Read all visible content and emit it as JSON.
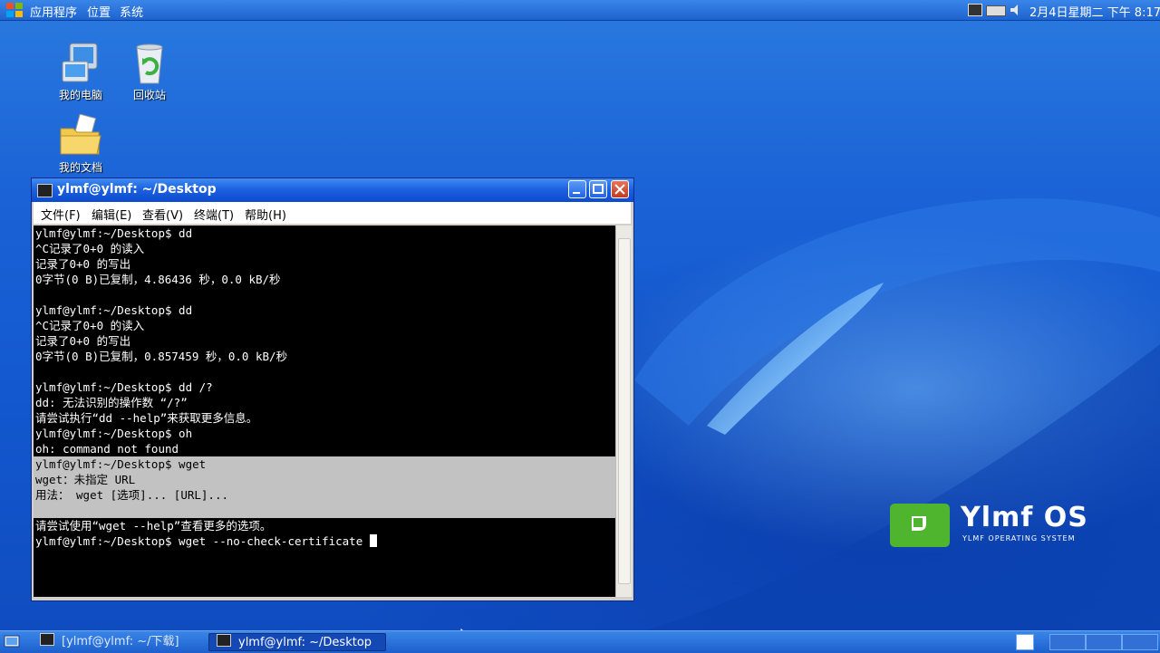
{
  "top_panel": {
    "menus": [
      "应用程序",
      "位置",
      "系统"
    ],
    "clock": "2月4日星期二 下午 8:17",
    "tray_icons": [
      "network-icon",
      "battery-icon",
      "volume-icon"
    ]
  },
  "desktop": {
    "icons": [
      {
        "label": "我的电脑",
        "icon": "computer-icon"
      },
      {
        "label": "回收站",
        "icon": "recycle-bin-icon"
      },
      {
        "label": "我的文档",
        "icon": "folder-icon"
      }
    ],
    "brand": {
      "name": "Ylmf OS",
      "tagline": "YLMF OPERATING SYSTEM"
    }
  },
  "terminal_window": {
    "title": "ylmf@ylmf: ~/Desktop",
    "menu": [
      "文件(F)",
      "编辑(E)",
      "查看(V)",
      "终端(T)",
      "帮助(H)"
    ],
    "lines": [
      "ylmf@ylmf:~/Desktop$ dd",
      "^C记录了0+0 的读入",
      "记录了0+0 的写出",
      "0字节(0 B)已复制，4.86436 秒，0.0 kB/秒",
      "",
      "ylmf@ylmf:~/Desktop$ dd",
      "^C记录了0+0 的读入",
      "记录了0+0 的写出",
      "0字节(0 B)已复制，0.857459 秒，0.0 kB/秒",
      "",
      "ylmf@ylmf:~/Desktop$ dd /?",
      "dd: 无法识别的操作数 “/?”",
      "请尝试执行“dd --help”来获取更多信息。",
      "ylmf@ylmf:~/Desktop$ oh",
      "oh: command not found",
      "ylmf@ylmf:~/Desktop$ wget",
      "wget：未指定 URL",
      "用法： wget [选项]... [URL]...",
      "",
      "请尝试使用“wget --help”查看更多的选项。",
      "ylmf@ylmf:~/Desktop$ wget --no-check-certificate "
    ]
  },
  "taskbar": {
    "items": [
      {
        "label": "[ylmf@ylmf: ~/下载]",
        "active": false
      },
      {
        "label": "ylmf@ylmf: ~/Desktop",
        "active": true
      }
    ]
  },
  "colors": {
    "panel": "#1e63cf",
    "titlebar": "#1d62e0",
    "highlight": "#c2c2c2",
    "terminal_bg": "#000000"
  }
}
